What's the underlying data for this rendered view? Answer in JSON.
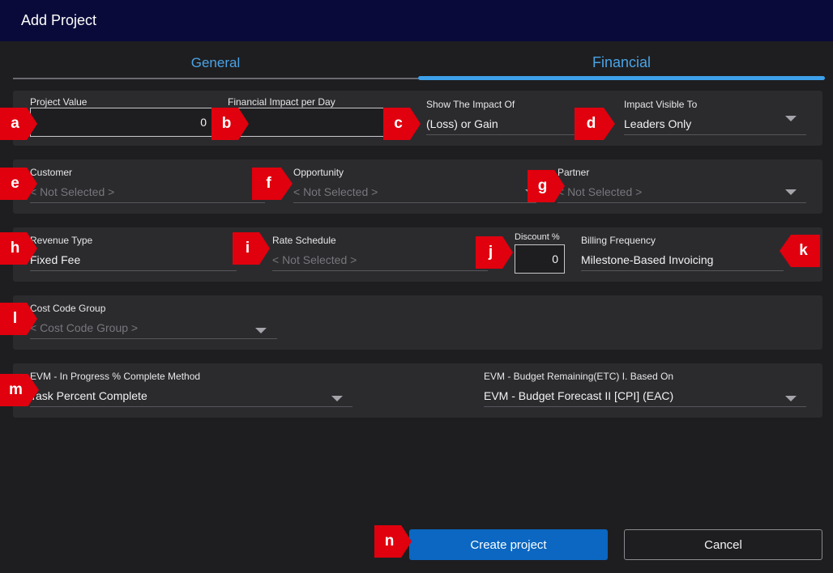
{
  "dialog": {
    "title": "Add Project"
  },
  "tabs": [
    {
      "label": "General",
      "active": false
    },
    {
      "label": "Financial",
      "active": true
    }
  ],
  "fields": {
    "project_value": {
      "label": "Project Value",
      "value": "0"
    },
    "financial_impact": {
      "label": "Financial Impact per Day",
      "value": ""
    },
    "show_impact": {
      "label": "Show The Impact Of",
      "value": "(Loss) or Gain"
    },
    "impact_visible": {
      "label": "Impact Visible To",
      "value": "Leaders Only"
    },
    "customer": {
      "label": "Customer",
      "value": "< Not Selected >"
    },
    "opportunity": {
      "label": "Opportunity",
      "value": "< Not Selected >"
    },
    "partner": {
      "label": "Partner",
      "value": "< Not Selected >"
    },
    "revenue_type": {
      "label": "Revenue Type",
      "value": "Fixed Fee"
    },
    "rate_schedule": {
      "label": "Rate Schedule",
      "value": "< Not Selected >"
    },
    "discount": {
      "label": "Discount %",
      "value": "0"
    },
    "billing_frequency": {
      "label": "Billing Frequency",
      "value": "Milestone-Based Invoicing"
    },
    "cost_code_group": {
      "label": "Cost Code Group",
      "value": "< Cost Code Group >"
    },
    "evm_method": {
      "label": "EVM - In Progress % Complete Method",
      "value": "Task Percent Complete"
    },
    "evm_budget": {
      "label": "EVM - Budget Remaining(ETC) I. Based On",
      "value": "EVM - Budget Forecast II [CPI] (EAC)"
    }
  },
  "markers": [
    "a",
    "b",
    "c",
    "d",
    "e",
    "f",
    "g",
    "h",
    "i",
    "j",
    "k",
    "l",
    "m",
    "n"
  ],
  "buttons": {
    "create": "Create project",
    "cancel": "Cancel"
  },
  "colors": {
    "title_bar": "#0a0a3a",
    "accent": "#3da0ea",
    "primary_button": "#0b67c1",
    "marker": "#e0000e",
    "panel": "#2b2b2e",
    "background": "#1e1e20"
  }
}
